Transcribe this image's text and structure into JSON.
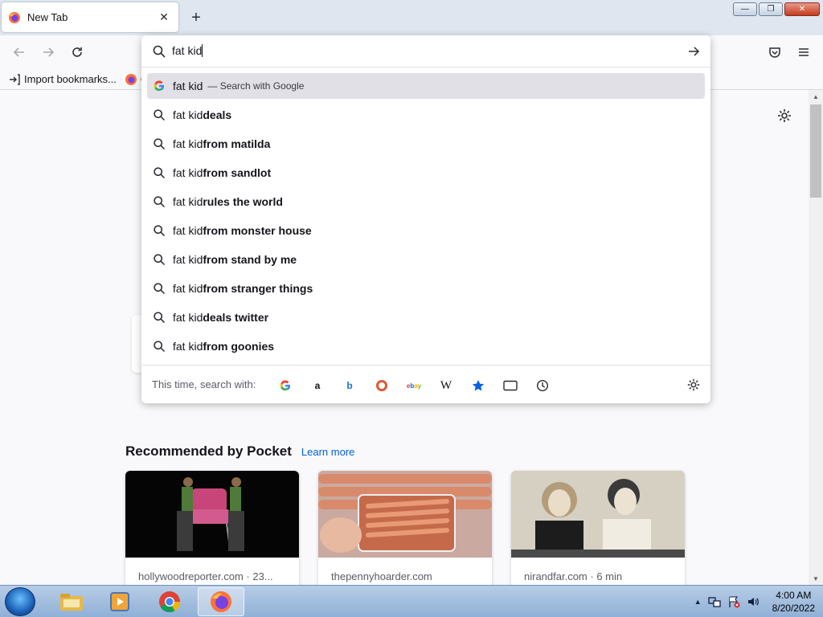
{
  "tab": {
    "title": "New Tab",
    "close": "✕",
    "new_tab": "+"
  },
  "window": {
    "minimize": "—",
    "maximize": "❐",
    "close": "✕"
  },
  "bookmarks": [
    {
      "label": "Import bookmarks..."
    },
    {
      "label": "G"
    }
  ],
  "urlbar": {
    "value": "fat kid",
    "suggestions": [
      {
        "prefix": "fat kid",
        "bold": "",
        "action": "— Search with Google",
        "icon": "google-icon",
        "selected": true
      },
      {
        "prefix": "fat kid",
        "bold": "deals",
        "action": "",
        "icon": "search-icon",
        "selected": false
      },
      {
        "prefix": "fat kid",
        "bold": "from matilda",
        "action": "",
        "icon": "search-icon",
        "selected": false
      },
      {
        "prefix": "fat kid",
        "bold": "from sandlot",
        "action": "",
        "icon": "search-icon",
        "selected": false
      },
      {
        "prefix": "fat kid",
        "bold": "rules the world",
        "action": "",
        "icon": "search-icon",
        "selected": false
      },
      {
        "prefix": "fat kid",
        "bold": "from monster house",
        "action": "",
        "icon": "search-icon",
        "selected": false
      },
      {
        "prefix": "fat kid",
        "bold": "from stand by me",
        "action": "",
        "icon": "search-icon",
        "selected": false
      },
      {
        "prefix": "fat kid",
        "bold": "from stranger things",
        "action": "",
        "icon": "search-icon",
        "selected": false
      },
      {
        "prefix": "fat kid",
        "bold": "deals twitter",
        "action": "",
        "icon": "search-icon",
        "selected": false
      },
      {
        "prefix": "fat kid",
        "bold": "from goonies",
        "action": "",
        "icon": "search-icon",
        "selected": false
      }
    ],
    "oneoff_label": "This time, search with:",
    "oneoffs": [
      "google-icon",
      "amazon-icon",
      "bing-icon",
      "duckduckgo-icon",
      "ebay-icon",
      "wikipedia-icon",
      "bookmarks-star-icon",
      "tabs-icon",
      "history-icon"
    ]
  },
  "pocket": {
    "title": "Recommended by Pocket",
    "learn_more": "Learn more",
    "cards": [
      {
        "source": "hollywoodreporter.com · 23..."
      },
      {
        "source": "thepennyhoarder.com"
      },
      {
        "source": "nirandfar.com · 6 min"
      }
    ]
  },
  "taskbar": {
    "apps": [
      "explorer-icon",
      "media-player-icon",
      "chrome-icon",
      "firefox-icon"
    ],
    "active_app": "firefox-icon",
    "time": "4:00 AM",
    "date": "8/20/2022"
  },
  "colors": {
    "accent": "#0061e0",
    "selected_row": "#e0e0e6",
    "tabstrip": "#dfe6f0",
    "taskbar": "#9cb9dd"
  }
}
